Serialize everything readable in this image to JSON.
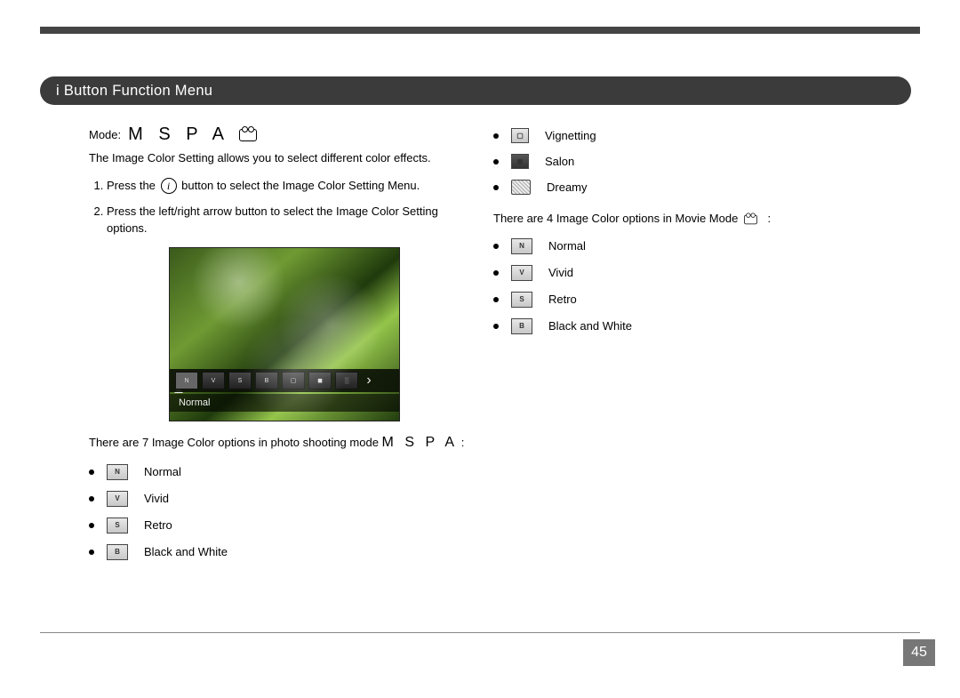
{
  "header": {
    "title": "i Button Function Menu"
  },
  "left": {
    "mode_label": "Mode:",
    "intro": "The Image Color Setting allows you to select different color effects.",
    "steps": [
      "Press the  button to select the Image Color Setting Menu.",
      "Press the left/right arrow button to select the Image Color Setting options."
    ],
    "preview_label": "Normal",
    "options_intro_a": "There are 7 Image Color options in photo shooting mode ",
    "options_intro_b": " :",
    "options": [
      "Normal",
      "Vivid",
      "Retro",
      "Black and White"
    ]
  },
  "right": {
    "top_options": [
      "Vignetting",
      "Salon",
      "Dreamy"
    ],
    "movie_intro_a": "There are 4 Image Color options in Movie Mode ",
    "movie_intro_b": " :",
    "movie_options": [
      "Normal",
      "Vivid",
      "Retro",
      "Black and White"
    ]
  },
  "page_number": "45",
  "mode_letters": "M S P A",
  "icon_letters": {
    "n": "N",
    "v": "V",
    "s": "S",
    "b": "B"
  }
}
